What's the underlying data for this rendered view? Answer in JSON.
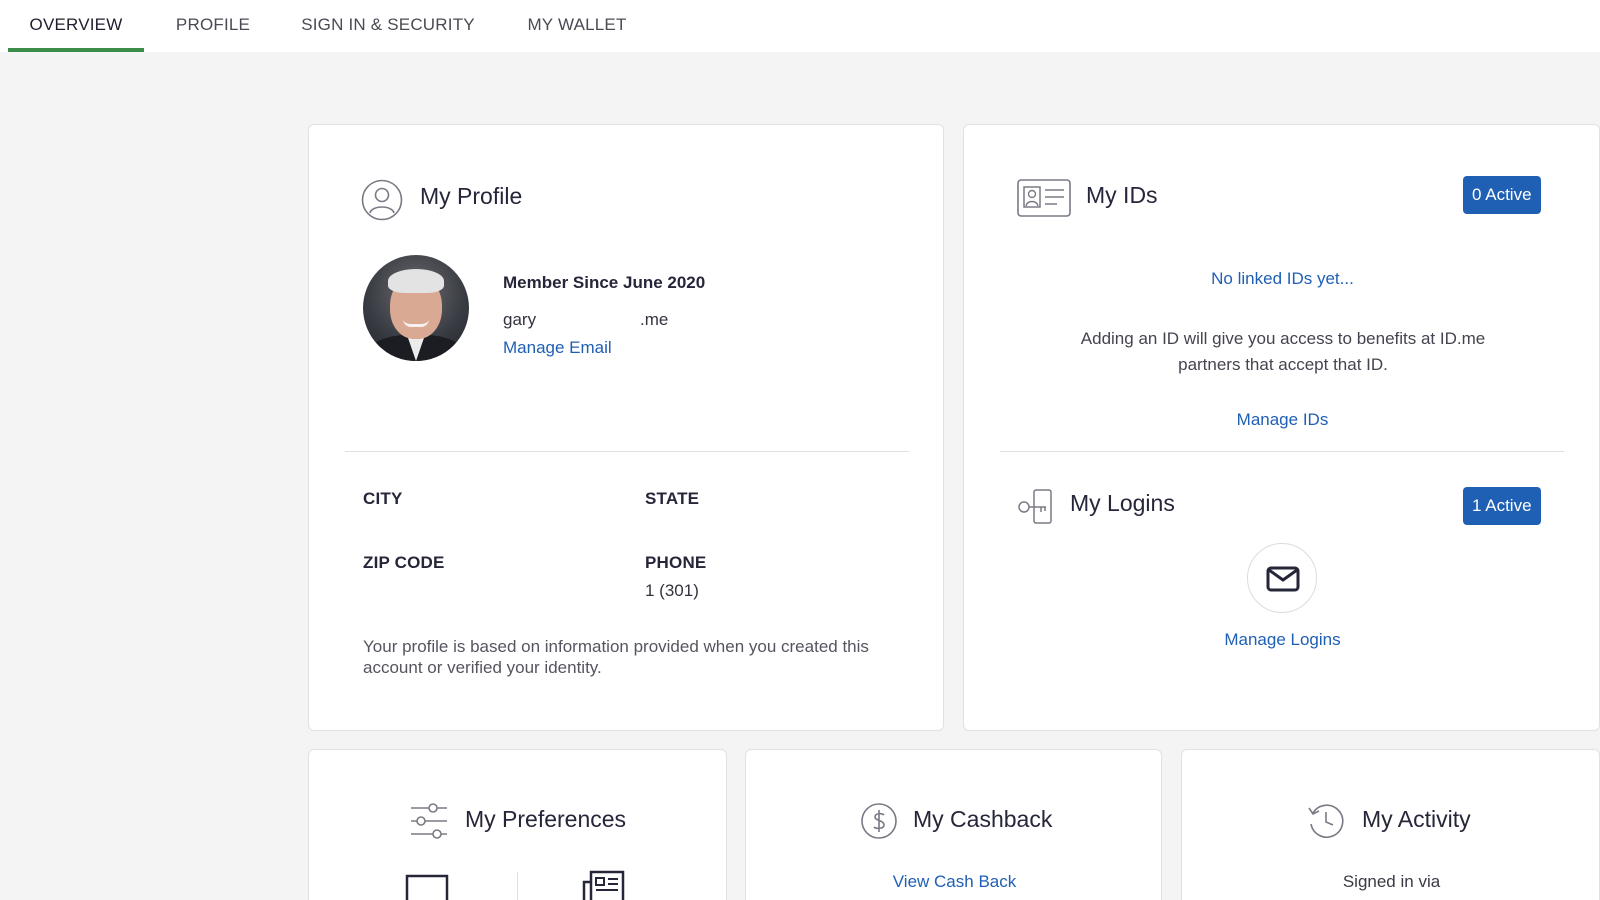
{
  "nav": {
    "tabs": [
      {
        "label": "OVERVIEW",
        "active": true
      },
      {
        "label": "PROFILE",
        "active": false
      },
      {
        "label": "SIGN IN & SECURITY",
        "active": false
      },
      {
        "label": "MY WALLET",
        "active": false
      }
    ]
  },
  "profile": {
    "title": "My Profile",
    "member_since": "Member Since June 2020",
    "email_start": "gary",
    "email_end": ".me",
    "manage_email": "Manage Email",
    "city_label": "CITY",
    "state_label": "STATE",
    "zip_label": "ZIP CODE",
    "phone_label": "PHONE",
    "phone_value": "1 (301)",
    "note": "Your profile is based on information provided when you created this account or verified your identity."
  },
  "ids": {
    "title": "My IDs",
    "badge": "0 Active",
    "empty": "No linked IDs yet...",
    "desc": "Adding an ID will give you access to benefits at ID.me partners that accept that ID.",
    "manage": "Manage IDs"
  },
  "logins": {
    "title": "My Logins",
    "badge": "1 Active",
    "manage": "Manage Logins"
  },
  "preferences": {
    "title": "My Preferences"
  },
  "cashback": {
    "title": "My Cashback",
    "link": "View Cash Back"
  },
  "activity": {
    "title": "My Activity",
    "text": "Signed in via"
  },
  "colors": {
    "accent": "#1f5fb4",
    "active_tab": "#3d8d4a"
  }
}
